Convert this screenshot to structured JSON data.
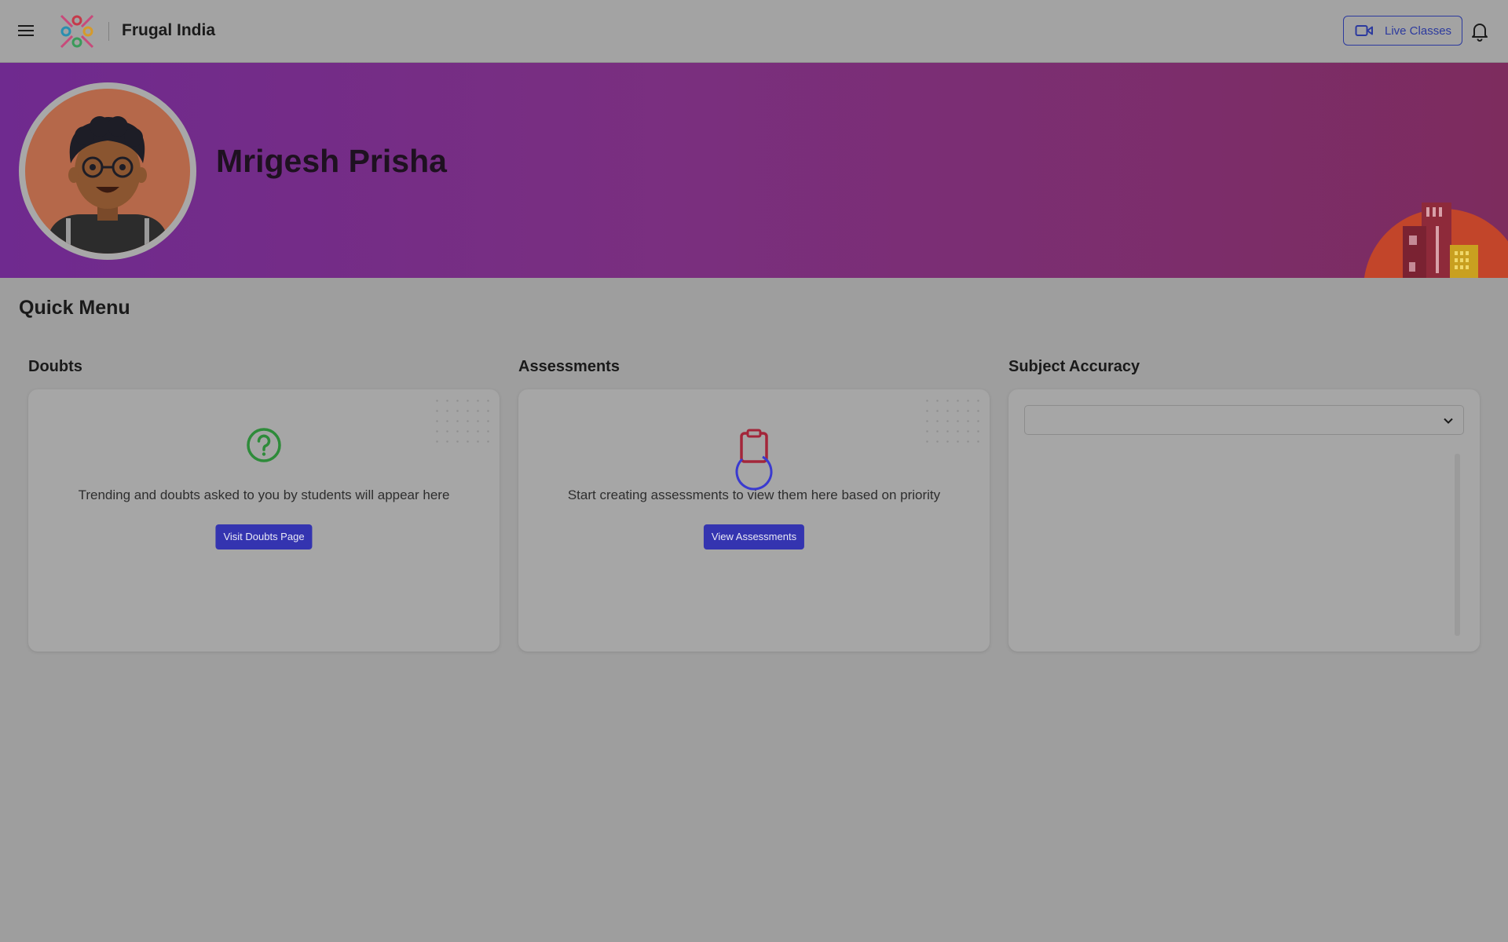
{
  "header": {
    "brand_name": "Frugal India",
    "live_classes_label": "Live Classes",
    "icons": [
      "menu-icon",
      "logo",
      "video-camera-icon",
      "bell-icon"
    ]
  },
  "profile": {
    "name": "Mrigesh Prisha"
  },
  "quick_menu": {
    "title": "Quick Menu",
    "doubts": {
      "title": "Doubts",
      "message": "Trending and doubts asked to you by students will appear here",
      "button_label": "Visit Doubts Page",
      "icon": "question-circle-icon"
    },
    "assessments": {
      "title": "Assessments",
      "message": "Start creating assessments to view them here based on priority",
      "button_label": "View Assessments",
      "icon": "clipboard-icon"
    },
    "subject_accuracy": {
      "title": "Subject Accuracy",
      "selected_value": ""
    }
  },
  "colors": {
    "primary_button": "#3434b0",
    "banner_start": "#6f2a8f",
    "banner_end": "#7d2c5e",
    "doubts_icon": "#2e8b3a",
    "assessments_icon": "#a3263a"
  }
}
